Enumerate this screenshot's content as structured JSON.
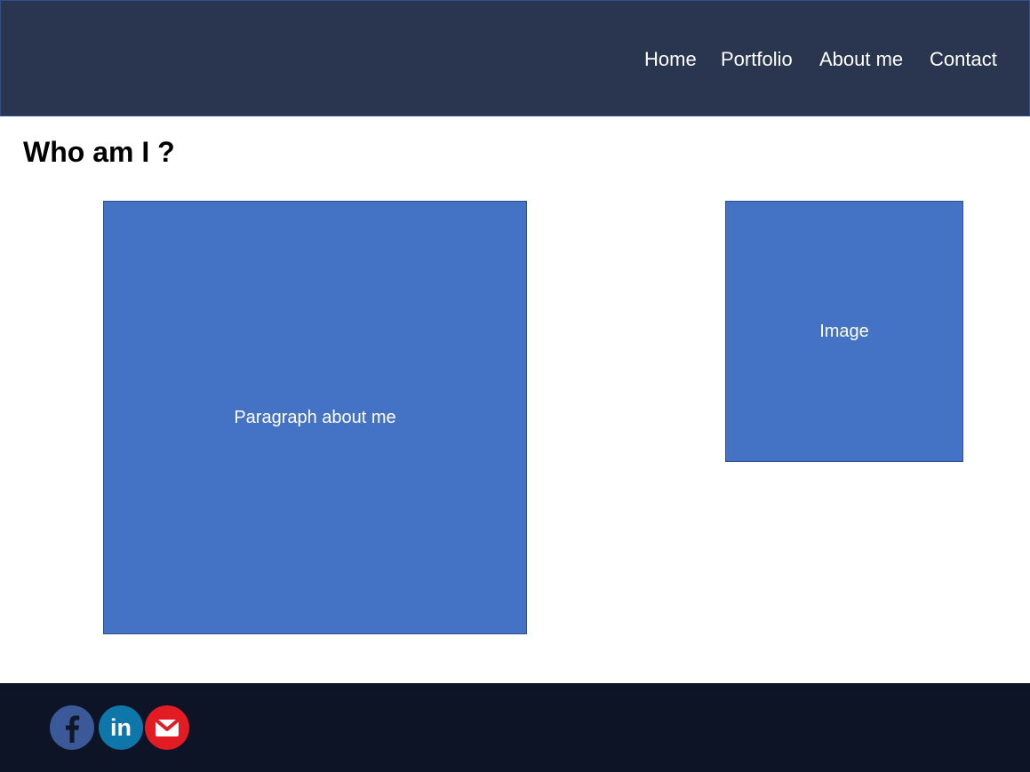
{
  "header": {
    "nav": [
      {
        "label": "Home"
      },
      {
        "label": "Portfolio"
      },
      {
        "label": "About me"
      },
      {
        "label": "Contact"
      }
    ]
  },
  "main": {
    "title": "Who am I ?",
    "paragraph_placeholder": "Paragraph about me",
    "image_placeholder": "Image"
  },
  "footer": {
    "social": [
      {
        "icon": "facebook-icon",
        "color": "#3b5998"
      },
      {
        "icon": "linkedin-icon",
        "color": "#0e76a8",
        "text": "in"
      },
      {
        "icon": "mail-icon",
        "color": "#e31b23"
      }
    ]
  },
  "colors": {
    "header_bg": "#2a364f",
    "placeholder_blue": "#4472c4",
    "footer_bg": "#0d1426"
  }
}
